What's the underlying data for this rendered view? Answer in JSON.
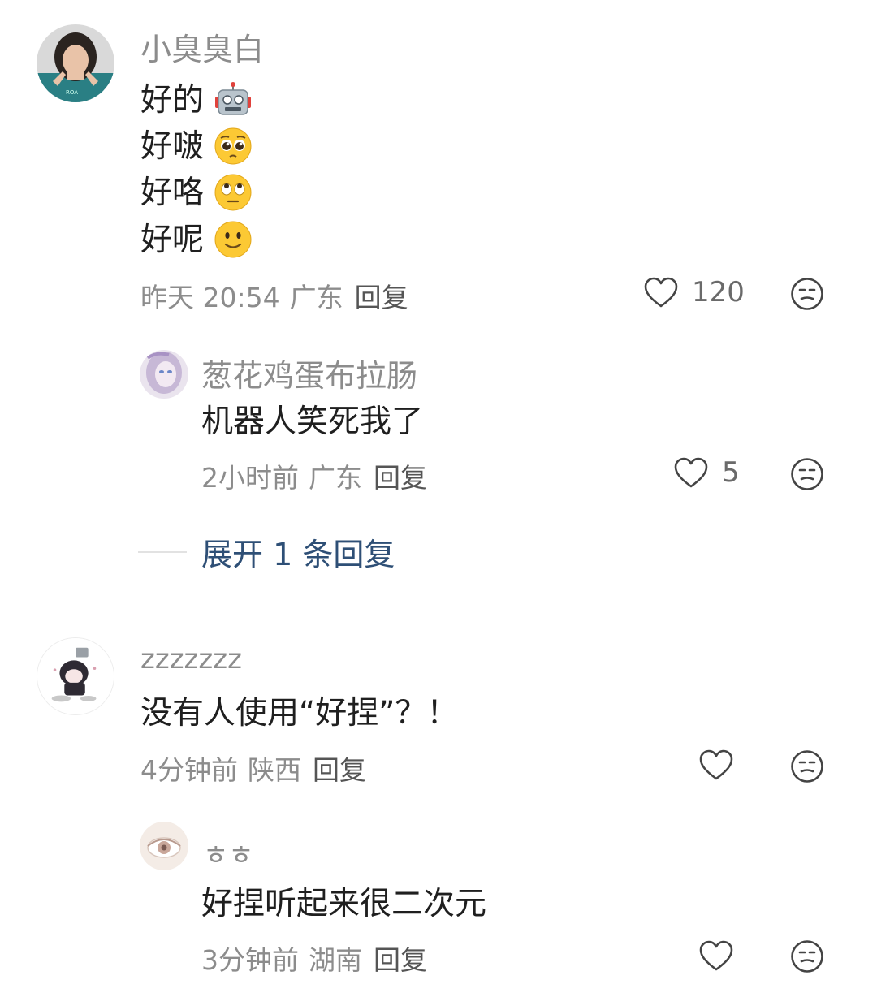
{
  "comments": [
    {
      "username": "小臭臭白",
      "lines": [
        {
          "text": "好的",
          "emoji": "robot-emoji"
        },
        {
          "text": "好啵",
          "emoji": "pleading-face-emoji"
        },
        {
          "text": "好咯",
          "emoji": "eye-roll-emoji"
        },
        {
          "text": "好呢",
          "emoji": "slight-smile-emoji"
        }
      ],
      "time": "昨天 20:54",
      "location": "广东",
      "reply_label": "回复",
      "like_count": "120",
      "replies": [
        {
          "username": "葱花鸡蛋布拉肠",
          "text": "机器人笑死我了",
          "time": "2小时前",
          "location": "广东",
          "reply_label": "回复",
          "like_count": "5"
        }
      ],
      "expand_label": "展开 1 条回复"
    },
    {
      "username": "zzzzzzz",
      "text": "没有人使用“好捏”？！",
      "time": "4分钟前",
      "location": "陕西",
      "reply_label": "回复",
      "like_count": "",
      "replies": [
        {
          "username": "ㅎㅎ",
          "text": "好捏听起来很二次元",
          "time": "3分钟前",
          "location": "湖南",
          "reply_label": "回复",
          "like_count": ""
        }
      ]
    }
  ],
  "colors": {
    "username": "#8c8c8c",
    "body_text": "#1f1f1f",
    "expand_link": "#2e4f76",
    "icon_gray": "#444444"
  }
}
